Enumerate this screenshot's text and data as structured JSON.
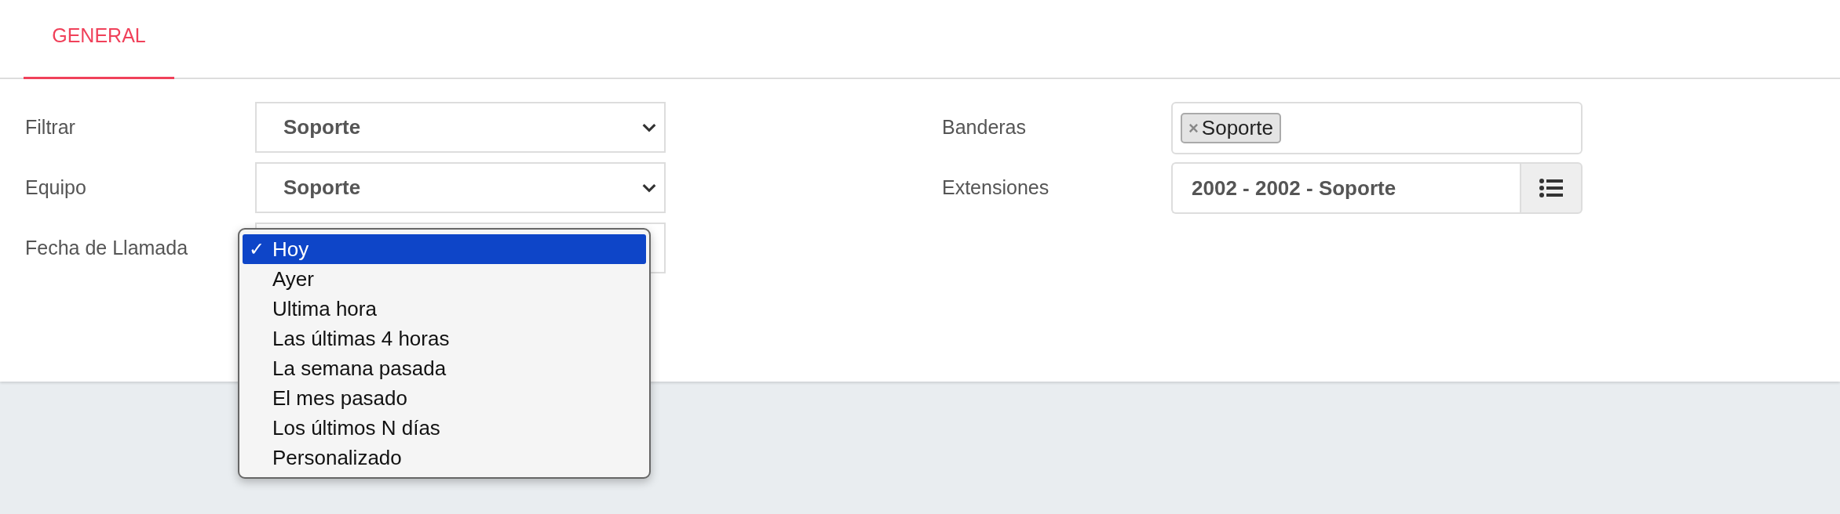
{
  "tabs": [
    {
      "label": "GENERAL",
      "selected": true
    }
  ],
  "left_fields": [
    {
      "label": "Filtrar",
      "kind": "select",
      "value": "Soporte"
    },
    {
      "label": "Equipo",
      "kind": "select",
      "value": "Soporte"
    },
    {
      "label": "Fecha de Llamada",
      "kind": "select",
      "expanded": true,
      "check_mark": "✓",
      "options": [
        {
          "label": "Hoy",
          "selected": true
        },
        {
          "label": "Ayer",
          "selected": false
        },
        {
          "label": "Ultima hora",
          "selected": false
        },
        {
          "label": "Las últimas 4 horas",
          "selected": false
        },
        {
          "label": "La semana pasada",
          "selected": false
        },
        {
          "label": "El mes pasado",
          "selected": false
        },
        {
          "label": "Los últimos N días",
          "selected": false
        },
        {
          "label": "Personalizado",
          "selected": false
        }
      ]
    }
  ],
  "right_fields": [
    {
      "label": "Banderas",
      "kind": "tags",
      "tags": [
        {
          "label": "Soporte",
          "remove": "×"
        }
      ]
    },
    {
      "label": "Extensiones",
      "kind": "picker",
      "value": "2002 - 2002 - Soporte"
    }
  ]
}
